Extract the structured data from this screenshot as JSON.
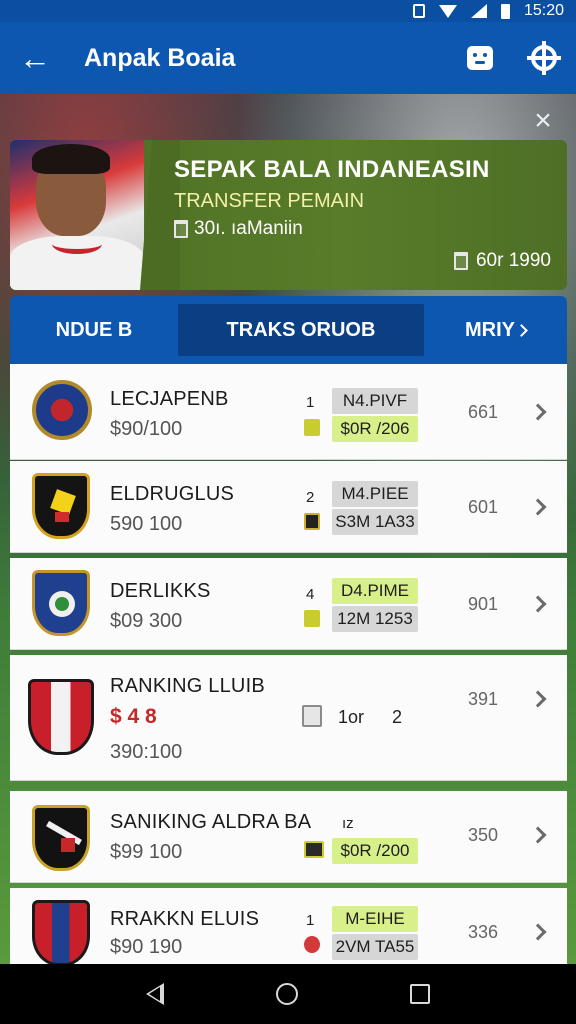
{
  "status_bar": {
    "time": "15:20"
  },
  "app_bar": {
    "title": "Anpak Boaia"
  },
  "banner": {
    "title": "SEPAK BALA INDANEASIN",
    "subtitle": "TRANSFER PEMAIN",
    "meta": "30ı. ıaManiin",
    "right_value": "60r 1990"
  },
  "tabs": [
    {
      "label": "NDUE B"
    },
    {
      "label": "TRAKS ORUOB"
    },
    {
      "label": "MRIY"
    }
  ],
  "clubs": [
    {
      "name": "LECJAPENB",
      "value": "$90/100",
      "rank": "1",
      "pill1": "N4.PIVF",
      "pill2": "$0R /206",
      "stat": "661"
    },
    {
      "name": "ELDRUGLUS",
      "value": "590 100",
      "rank": "2",
      "pill1": "M4.PIEE",
      "pill2": "S3M 1A33",
      "stat": "601"
    },
    {
      "name": "DERLIKKS",
      "value": "$09 300",
      "rank": "4",
      "pill1": "D4.PIME",
      "pill2": "12M 1253",
      "stat": "901"
    },
    {
      "name": "RANKING LLUIB",
      "value": "390:100",
      "rank": "1or",
      "rank2": "2",
      "emoji_line": "$ 4 8",
      "stat": "391"
    },
    {
      "name": "SANIKING ALDRA BA",
      "value": "$99 100",
      "rank": "ız",
      "pill2": "$0R /200",
      "stat": "350"
    },
    {
      "name": "RRAKKN ELUIS",
      "value": "$90 190",
      "rank": "1",
      "pill1": "M-EIHE",
      "pill2": "2VM TA55",
      "stat": "336"
    }
  ]
}
